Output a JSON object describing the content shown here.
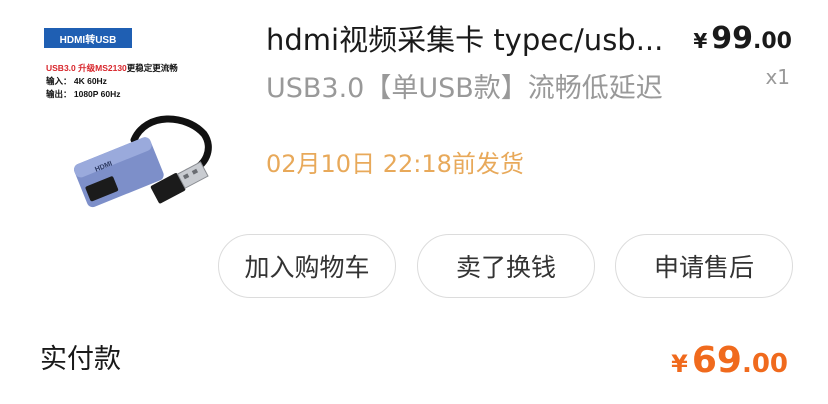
{
  "product": {
    "title": "hdmi视频采集卡 typec/usb...",
    "spec": "USB3.0【单USB款】流畅低延迟",
    "ship_time": "02月10日 22:18前发货",
    "price_symbol": "¥",
    "price_int": "99",
    "price_dec": ".00",
    "quantity": "x1"
  },
  "thumbnail": {
    "banner": "HDMI转USB",
    "line1_a": "USB3.0 升级",
    "line1_b": "MS2130",
    "line1_c": "更稳定更流畅",
    "line2": "输入：  4K 60Hz",
    "line3": "输出：  1080P 60Hz",
    "device_label": "HDMI"
  },
  "actions": {
    "add_to_cart": "加入购物车",
    "resell": "卖了换钱",
    "after_sale": "申请售后"
  },
  "payment": {
    "label": "实付款",
    "symbol": "¥",
    "int": "69",
    "dec": ".00"
  },
  "colors": {
    "ship_time": "#e8a95a",
    "paid_price": "#f06a1d",
    "banner": "#1f5fb3"
  }
}
